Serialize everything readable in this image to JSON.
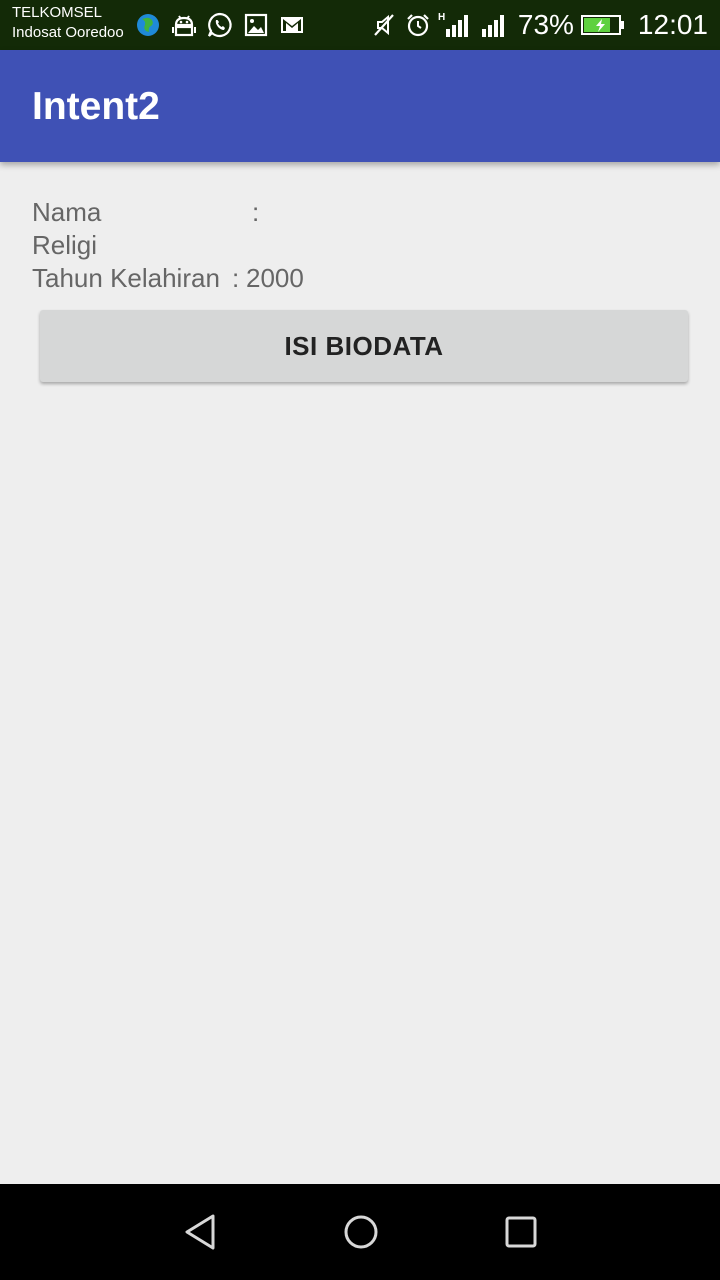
{
  "status_bar": {
    "carrier_1": "TELKOMSEL",
    "carrier_2": "Indosat Ooredoo",
    "battery_percent": "73%",
    "clock": "12:01",
    "network_type": "H",
    "notification_icons": [
      "globe-icon",
      "android-icon",
      "whatsapp-icon",
      "gallery-icon",
      "gmail-icon"
    ],
    "system_icons": [
      "mute-icon",
      "alarm-icon",
      "signal-icon",
      "signal-icon",
      "battery-charging-icon"
    ]
  },
  "app_bar": {
    "title": "Intent2",
    "color": "#3f51b5"
  },
  "biodata": {
    "nama_label": "Nama",
    "nama_separator": ":",
    "nama_value": "",
    "religi_label": "Religi",
    "tahun_label": "Tahun Kelahiran",
    "tahun_separator": ":",
    "tahun_value": "2000"
  },
  "button": {
    "label": "ISI BIODATA"
  },
  "nav_bar": {
    "icons": [
      "back-icon",
      "home-icon",
      "recent-apps-icon"
    ]
  }
}
